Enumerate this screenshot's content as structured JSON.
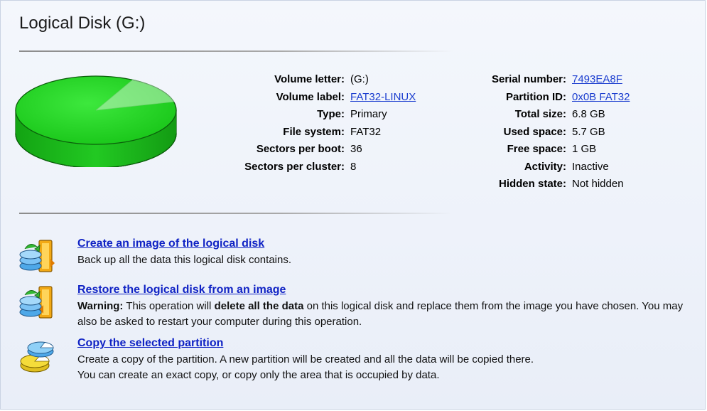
{
  "header": {
    "title": "Logical Disk (G:)"
  },
  "properties_left": [
    {
      "label": "Volume letter:",
      "value": "(G:)",
      "link": false
    },
    {
      "label": "Volume label:",
      "value": "FAT32-LINUX",
      "link": true
    },
    {
      "label": "Type:",
      "value": "Primary",
      "link": false
    },
    {
      "label": "File system:",
      "value": "FAT32",
      "link": false
    },
    {
      "label": "Sectors per boot:",
      "value": "36",
      "link": false
    },
    {
      "label": "Sectors per cluster:",
      "value": "8",
      "link": false
    }
  ],
  "properties_right": [
    {
      "label": "Serial number:",
      "value": "7493EA8F",
      "link": true
    },
    {
      "label": "Partition ID:",
      "value": "0x0B FAT32",
      "link": true
    },
    {
      "label": "Total size:",
      "value": "6.8 GB",
      "link": false
    },
    {
      "label": "Used space:",
      "value": "5.7 GB",
      "link": false
    },
    {
      "label": "Free space:",
      "value": "1 GB",
      "link": false
    },
    {
      "label": "Activity:",
      "value": "Inactive",
      "link": false
    },
    {
      "label": "Hidden state:",
      "value": "Not hidden",
      "link": false
    }
  ],
  "actions": [
    {
      "title": "Create an image of the logical disk",
      "desc_line1": "Back up all the data this logical disk contains.",
      "icon": "backup-image-icon"
    },
    {
      "title": "Restore the logical disk from an image",
      "warn_label": "Warning:",
      "warn_text1": " This operation will ",
      "warn_bold": "delete all the data",
      "warn_text2": " on this logical disk and replace them from the image you have chosen. You may also be asked to restart your computer during this operation.",
      "icon": "restore-image-icon"
    },
    {
      "title": "Copy the selected partition",
      "desc_line1": "Create a copy of the partition. A new partition will be created and all the data will be copied there.",
      "desc_line2": "You can create an exact copy, or copy only the area that is occupied by data.",
      "icon": "copy-partition-icon"
    }
  ],
  "colors": {
    "link": "#1a3ccf",
    "action_link": "#0f22c4",
    "disk_green": "#22c322"
  }
}
